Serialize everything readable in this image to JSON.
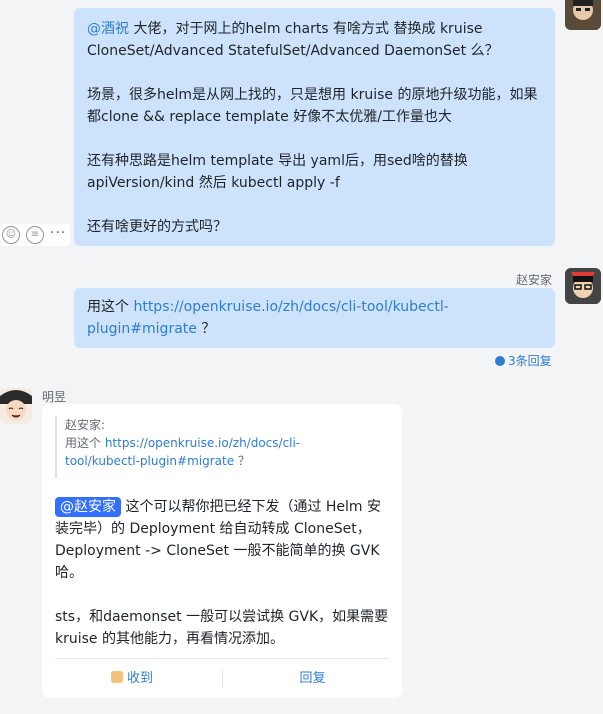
{
  "msg1": {
    "mention": "@酒祝",
    "lines": [
      " 大佬，对于网上的helm charts 有啥方式 替换成 kruise",
      "CloneSet/Advanced StatefulSet/Advanced DaemonSet 么？",
      "场景，很多helm是从网上找的，只是想用 kruise 的原地升级功能，如果",
      "都clone && replace template 好像不太优雅/工作量也大",
      "还有种思路是helm template 导出 yaml后，用sed啥的替换",
      "apiVersion/kind 然后 kubectl apply -f",
      "还有啥更好的方式吗？"
    ],
    "actions": {
      "react": "emoji-add-icon",
      "reply": "reply-icon",
      "more": "···"
    }
  },
  "msg2": {
    "sender": "赵安家",
    "text_prefix": "用这个 ",
    "link_line1": "https://openkruise.io/zh/docs/cli-tool/kubectl-",
    "link_line2": "plugin#migrate",
    "text_suffix": " ？",
    "thread_count": "3条回复"
  },
  "msg3": {
    "sender": "明昱",
    "quote": {
      "author": "赵安家:",
      "prefix": "用这个 ",
      "link1": "https://openkruise.io/zh/docs/cli-",
      "link2": "tool/kubectl-plugin#migrate",
      "suffix": " ？"
    },
    "mention": "@赵安家",
    "lines": [
      " 这个可以帮你把已经下发（通过 Helm 安",
      "装完毕）的 Deployment 给自动转成 CloneSet，",
      "Deployment -> CloneSet 一般不能简单的换 GVK",
      "哈。",
      "sts，和daemonset 一般可以尝试换 GVK，如果需要",
      "kruise 的其他能力，再看情况添加。"
    ],
    "ack_label": "收到",
    "reply_label": "回复"
  }
}
